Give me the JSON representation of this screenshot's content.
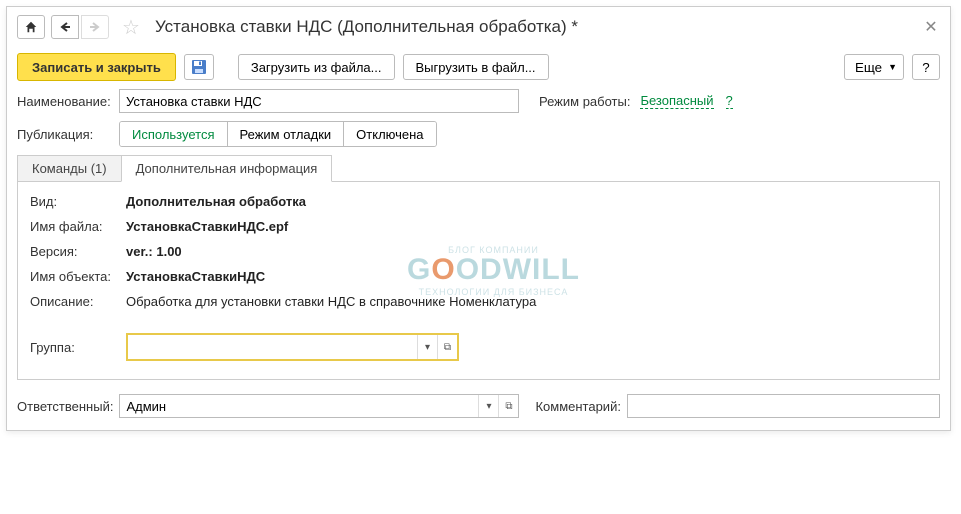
{
  "title": "Установка ставки НДС (Дополнительная обработка) *",
  "toolbar": {
    "saveClose": "Записать и закрыть",
    "loadFile": "Загрузить из файла...",
    "saveFile": "Выгрузить в файл...",
    "more": "Еще",
    "help": "?"
  },
  "form": {
    "nameLabel": "Наименование:",
    "nameValue": "Установка ставки НДС",
    "modeLabel": "Режим работы:",
    "modeValue": "Безопасный",
    "modeHelp": "?",
    "pubLabel": "Публикация:",
    "pubOptions": [
      "Используется",
      "Режим отладки",
      "Отключена"
    ]
  },
  "tabs": {
    "commands": "Команды (1)",
    "addInfo": "Дополнительная информация"
  },
  "info": {
    "kindLabel": "Вид:",
    "kind": "Дополнительная обработка",
    "fileLabel": "Имя файла:",
    "file": "УстановкаСтавкиНДС.epf",
    "versionLabel": "Версия:",
    "version": "ver.: 1.00",
    "objLabel": "Имя объекта:",
    "obj": "УстановкаСтавкиНДС",
    "descLabel": "Описание:",
    "desc": "Обработка для установки ставки НДС в справочнике Номенклатура",
    "groupLabel": "Группа:",
    "groupValue": ""
  },
  "footer": {
    "respLabel": "Ответственный:",
    "respValue": "Админ",
    "commentLabel": "Комментарий:",
    "commentValue": ""
  },
  "watermark": {
    "top": "БЛОГ КОМПАНИИ",
    "main1": "G",
    "mainO": "O",
    "main2": "ODWILL",
    "bottom": "ТЕХНОЛОГИИ ДЛЯ БИЗНЕСА"
  }
}
